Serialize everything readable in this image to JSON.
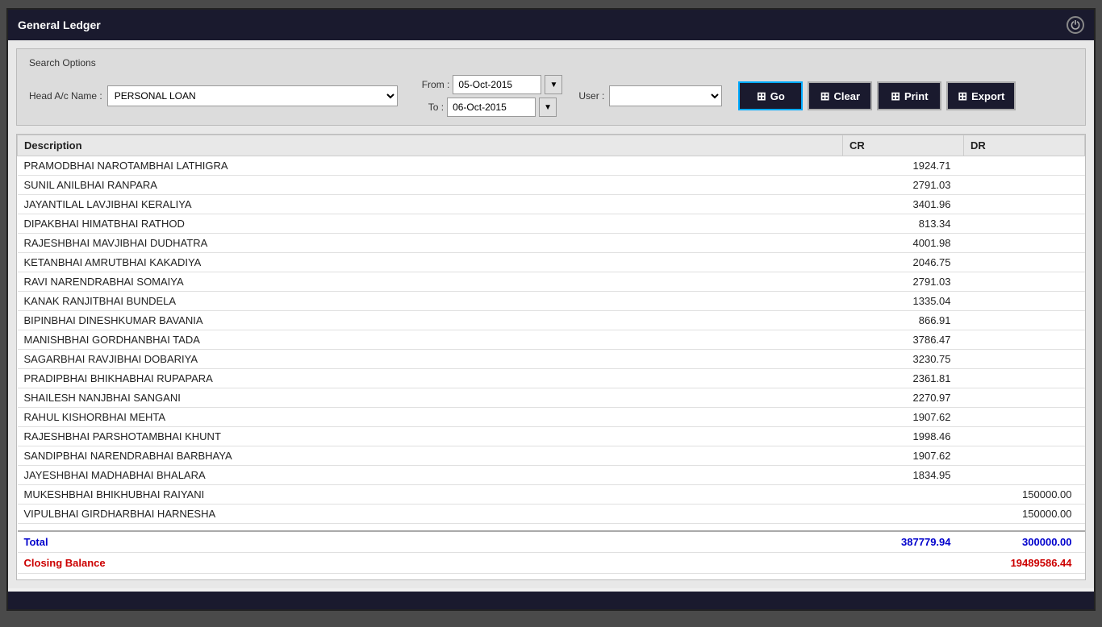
{
  "window": {
    "title": "General Ledger"
  },
  "search": {
    "title": "Search Options",
    "head_ac_label": "Head A/c Name :",
    "head_ac_value": "PERSONAL LOAN",
    "from_label": "From :",
    "from_date": "05-Oct-2015",
    "to_label": "To :",
    "to_date": "06-Oct-2015",
    "user_label": "User :",
    "user_value": ""
  },
  "buttons": {
    "go": "Go",
    "clear": "Clear",
    "print": "Print",
    "export": "Export"
  },
  "table": {
    "columns": [
      "Description",
      "CR",
      "DR"
    ],
    "rows": [
      {
        "description": "PRAMODBHAI NAROTAMBHAI  LATHIGRA",
        "cr": "1924.71",
        "dr": ""
      },
      {
        "description": "SUNIL ANILBHAI  RANPARA",
        "cr": "2791.03",
        "dr": ""
      },
      {
        "description": "JAYANTILAL LAVJIBHAI  KERALIYA",
        "cr": "3401.96",
        "dr": ""
      },
      {
        "description": "DIPAKBHAI HIMATBHAI RATHOD",
        "cr": "813.34",
        "dr": ""
      },
      {
        "description": "RAJESHBHAI  MAVJIBHAI  DUDHATRA",
        "cr": "4001.98",
        "dr": ""
      },
      {
        "description": "KETANBHAI  AMRUTBHAI KAKADIYA",
        "cr": "2046.75",
        "dr": ""
      },
      {
        "description": "RAVI  NARENDRABHAI SOMAIYA",
        "cr": "2791.03",
        "dr": ""
      },
      {
        "description": "KANAK RANJITBHAI  BUNDELA",
        "cr": "1335.04",
        "dr": ""
      },
      {
        "description": "BIPINBHAI DINESHKUMAR BAVANIA",
        "cr": "866.91",
        "dr": ""
      },
      {
        "description": "MANISHBHAI GORDHANBHAI TADA",
        "cr": "3786.47",
        "dr": ""
      },
      {
        "description": "SAGARBHAI RAVJIBHAI DOBARIYA",
        "cr": "3230.75",
        "dr": ""
      },
      {
        "description": "PRADIPBHAI BHIKHABHAI RUPAPARA",
        "cr": "2361.81",
        "dr": ""
      },
      {
        "description": "SHAILESH NANJBHAI SANGANI",
        "cr": "2270.97",
        "dr": ""
      },
      {
        "description": "RAHUL KISHORBHAI MEHTA",
        "cr": "1907.62",
        "dr": ""
      },
      {
        "description": "RAJESHBHAI PARSHOTAMBHAI KHUNT",
        "cr": "1998.46",
        "dr": ""
      },
      {
        "description": "SANDIPBHAI NARENDRABHAI BARBHAYA",
        "cr": "1907.62",
        "dr": ""
      },
      {
        "description": "JAYESHBHAI MADHABHAI BHALARA",
        "cr": "1834.95",
        "dr": ""
      },
      {
        "description": "MUKESHBHAI BHIKHUBHAI  RAIYANI",
        "cr": "",
        "dr": "150000.00"
      },
      {
        "description": "VIPULBHAI GIRDHARBHAI HARNESHA",
        "cr": "",
        "dr": "150000.00"
      },
      {
        "description": "",
        "cr": "",
        "dr": ""
      }
    ],
    "total_label": "Total",
    "total_cr": "387779.94",
    "total_dr": "300000.00",
    "closing_label": "Closing Balance",
    "closing_dr": "19489586.44"
  }
}
